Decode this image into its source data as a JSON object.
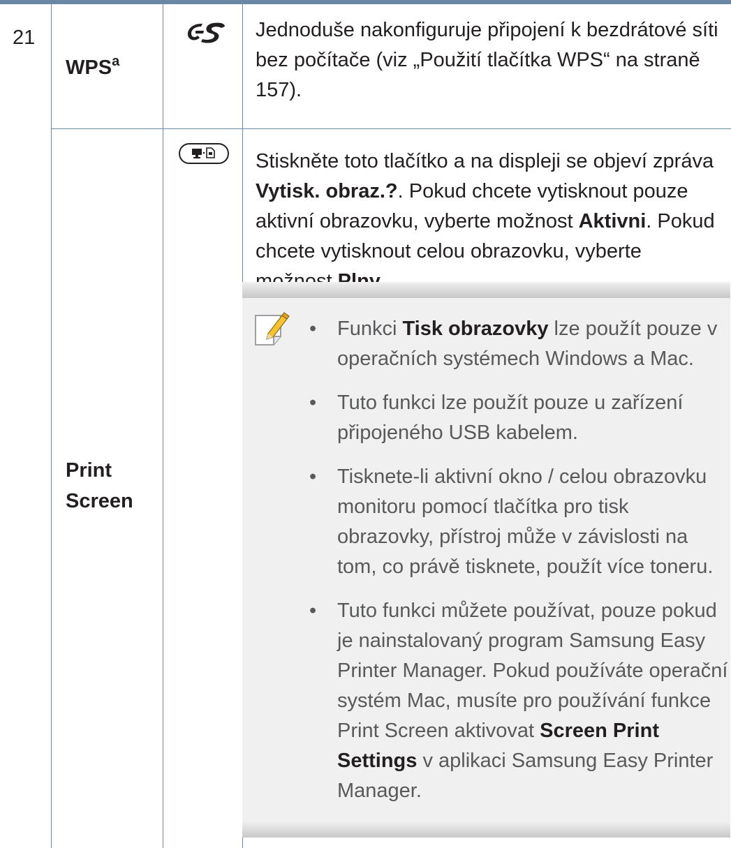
{
  "row_number": "21",
  "wps": {
    "name": "WPS",
    "footnote": "a",
    "description": "Jednoduše nakonfiguruje připojení k bezdrátové síti bez počítače (viz „Použití tlačítka WPS“ na straně 157)."
  },
  "print_screen": {
    "name_line1": "Print",
    "name_line2": "Screen",
    "desc_part1": "Stiskněte toto tlačítko a na displeji se objeví zpráva ",
    "desc_bold1": "Vytisk. obraz.?",
    "desc_part2": ". Pokud chcete vytisknout pouze aktivní obrazovku, vyberte možnost ",
    "desc_bold2": "Aktivni",
    "desc_part3": ". Pokud chcete vytisknout celou obrazovku, vyberte možnost ",
    "desc_bold3": "Plny",
    "desc_part4": "."
  },
  "note": {
    "bullet_glyph": "•",
    "b1_pre": "Funkci ",
    "b1_bold": "Tisk obrazovky",
    "b1_post": " lze použít pouze v operačních systémech Windows a Mac.",
    "b2": "Tuto funkci lze použít pouze u zařízení připojeného USB kabelem.",
    "b3": "Tisknete-li aktivní okno / celou obrazovku monitoru pomocí tlačítka pro tisk obrazovky, přístroj může v závislosti na tom, co právě tisknete, použít více toneru.",
    "b4_pre": "Tuto funkci můžete používat, pouze pokud je nainstalovaný program Samsung Easy Printer Manager. Pokud používáte operační systém Mac, musíte pro používání funkce Print Screen aktivovat ",
    "b4_bold": "Screen Print Settings",
    "b4_post": " v aplikaci Samsung Easy Printer Manager."
  },
  "colors": {
    "rule": "#6a88a6",
    "note_bg": "#f0f0f0",
    "note_text": "#58595b"
  }
}
